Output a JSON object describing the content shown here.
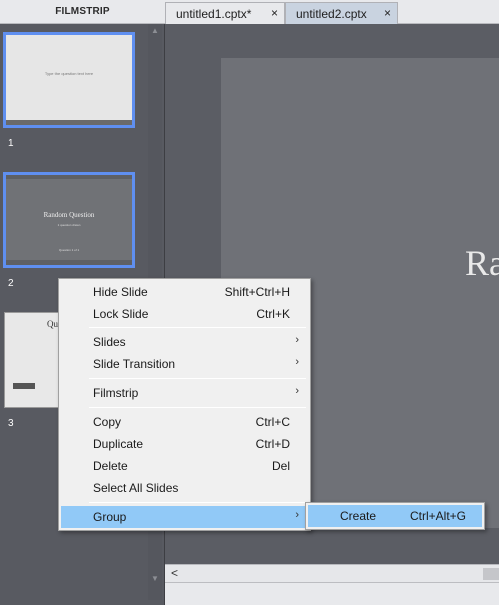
{
  "filmstrip": {
    "header": "FILMSTRIP",
    "slides": [
      {
        "number": "1",
        "caption": "Type the question text here"
      },
      {
        "number": "2",
        "title": "Random Question",
        "subtitle": "1 question drawn",
        "footer": "Question 1 of 1"
      },
      {
        "number": "3",
        "title": "Qu"
      }
    ]
  },
  "tabs": [
    {
      "label": "untitled1.cptx*",
      "close": "×"
    },
    {
      "label": "untitled2.cptx",
      "close": "×"
    }
  ],
  "stage": {
    "title_peek": "Ra"
  },
  "hscroll": {
    "left_arrow": "<"
  },
  "context_menu": {
    "items": [
      {
        "label": "Hide Slide",
        "shortcut": "Shift+Ctrl+H"
      },
      {
        "label": "Lock Slide",
        "shortcut": "Ctrl+K"
      },
      {
        "label": "Slides",
        "submenu": "›"
      },
      {
        "label": "Slide Transition",
        "submenu": "›"
      },
      {
        "label": "Filmstrip",
        "submenu": "›"
      },
      {
        "label": "Copy",
        "shortcut": "Ctrl+C"
      },
      {
        "label": "Duplicate",
        "shortcut": "Ctrl+D"
      },
      {
        "label": "Delete",
        "shortcut": "Del"
      },
      {
        "label": "Select All Slides"
      },
      {
        "label": "Group",
        "submenu": "›"
      }
    ]
  },
  "group_submenu": {
    "label": "Create",
    "shortcut": "Ctrl+Alt+G"
  },
  "colors": {
    "selection_border": "#5f8ff0",
    "menu_highlight": "#91c9f7",
    "panel_bg": "#585a61"
  }
}
